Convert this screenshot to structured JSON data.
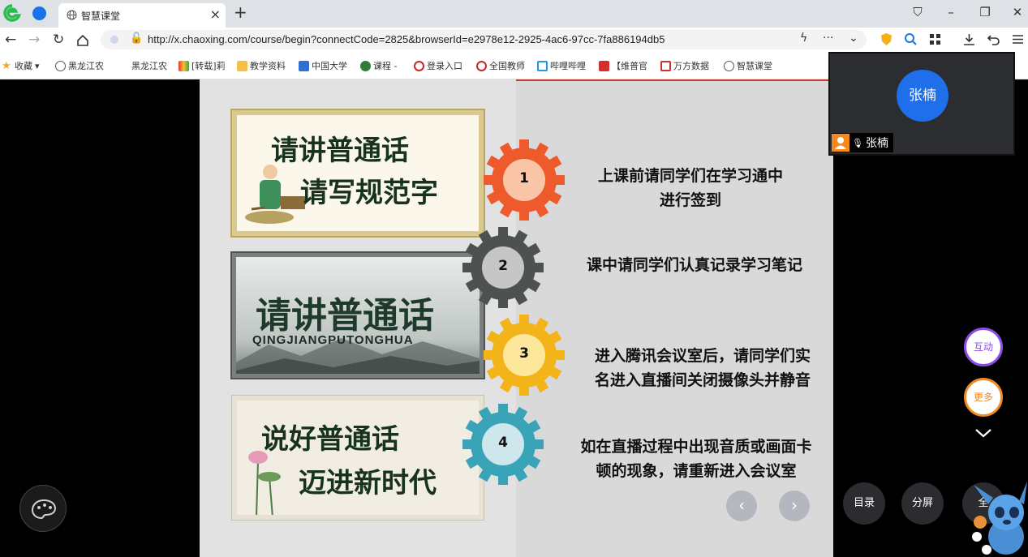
{
  "browser": {
    "tab_title": "智慧课堂",
    "url": "http://x.chaoxing.com/course/begin?connectCode=2825&browserId=e2978e12-2925-4ac6-97cc-7fa886194db5",
    "bookmarks": [
      "收藏",
      "黑龙江农",
      "黑龙江农",
      "[转载]莉",
      "教学资料",
      "中国大学",
      "课程 -",
      "登录入口",
      "全国教师",
      "哔哩哔哩",
      "【维普官",
      "万方数据",
      "智慧课堂"
    ]
  },
  "slide": {
    "cards": [
      {
        "line1": "请讲普通话",
        "line2": "请写规范字"
      },
      {
        "line1": "请讲普通话",
        "line2": "QINGJIANGPUTONGHUA"
      },
      {
        "line1": "说好普通话",
        "line2": "迈进新时代"
      }
    ],
    "steps": [
      {
        "number": "1",
        "line1": "上课前请同学们在学习通中",
        "line2": "进行签到",
        "color": "#ee5a2b",
        "inner": "#f9c5a6"
      },
      {
        "number": "2",
        "line1": "课中请同学们认真记录学习笔记",
        "line2": "",
        "color": "#4d5250",
        "inner": "#c6c6c6"
      },
      {
        "number": "3",
        "line1": "进入腾讯会议室后，请同学们实",
        "line2": "名进入直播间关闭摄像头并静音",
        "color": "#f3b41a",
        "inner": "#fde79a"
      },
      {
        "number": "4",
        "line1": "如在直播过程中出现音质或画面卡",
        "line2": "顿的现象，请重新进入会议室",
        "color": "#39a4b8",
        "inner": "#cde7ec"
      }
    ],
    "nav_prev": "‹",
    "nav_next": "›"
  },
  "video": {
    "avatar_name": "张楠",
    "label_name": "张楠"
  },
  "side_buttons": {
    "interact": "互动",
    "more": "更多"
  },
  "bottom_buttons": {
    "catalog": "目录",
    "split": "分屏",
    "full": "全"
  }
}
